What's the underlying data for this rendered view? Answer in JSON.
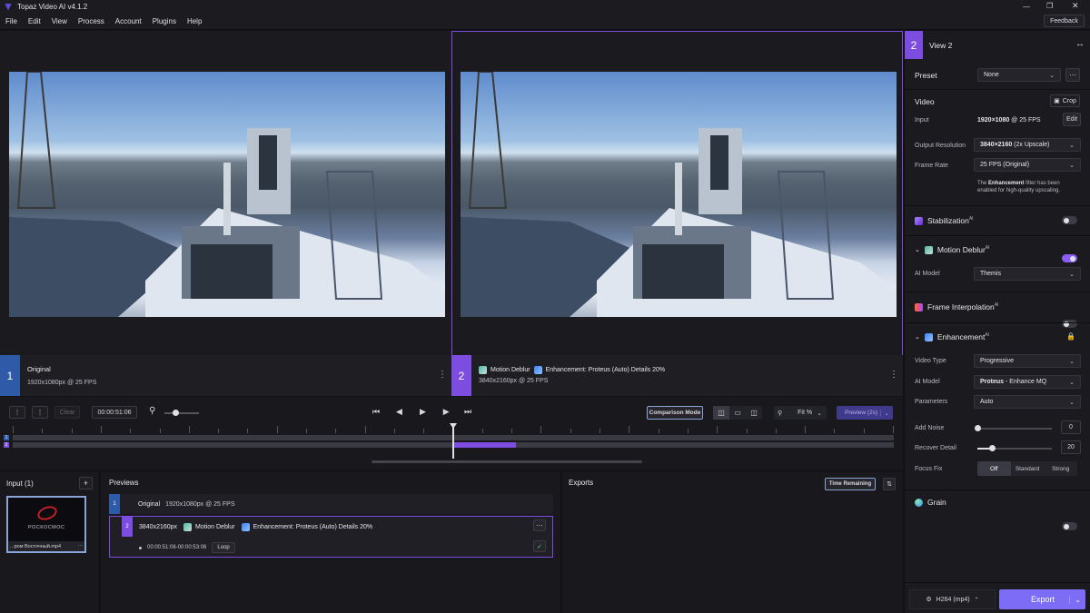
{
  "app": {
    "title": "Topaz Video AI  v4.1.2",
    "feedback": "Feedback"
  },
  "menu": [
    "File",
    "Edit",
    "View",
    "Process",
    "Account",
    "Plugins",
    "Help"
  ],
  "view1": {
    "num": "1",
    "title": "Original",
    "info": "1920x1080px @ 25 FPS"
  },
  "view2": {
    "num": "2",
    "filter1": "Motion Deblur",
    "filter2": "Enhancement: Proteus (Auto) Details 20%",
    "info": "3840x2160px @ 25 FPS"
  },
  "timeline": {
    "clear": "Clear",
    "time": "00:00:51:06",
    "comparison": "Comparison Mode",
    "zoom": "Fit %",
    "preview": "Preview (2s)",
    "track1": "1",
    "track2": "2"
  },
  "input": {
    "title": "Input (1)",
    "add": "+",
    "filename": "...ром Восточный.mp4",
    "logo": "РОСКОСМОС"
  },
  "previews": {
    "title": "Previews",
    "row1": {
      "num": "1",
      "title": "Original",
      "info": "1920x1080px @ 25 FPS"
    },
    "row2": {
      "num": "2",
      "res": "3840x2160px",
      "filter1": "Motion Deblur",
      "filter2": "Enhancement: Proteus (Auto) Details 20%",
      "range": "00:00:51:06-00:00:53:06",
      "loop": "Loop"
    }
  },
  "exports": {
    "title": "Exports",
    "time_remaining": "Time Remaining"
  },
  "right": {
    "view_num": "2",
    "view_title": "View 2",
    "preset_label": "Preset",
    "preset_value": "None",
    "video_label": "Video",
    "crop": "Crop",
    "input_label": "Input",
    "input_value_bold": "1920×1080",
    "input_value_rest": " @ 25 FPS",
    "edit": "Edit",
    "out_res_label": "Output Resolution",
    "out_res_bold": "3840×2160",
    "out_res_rest": " (2x Upscale)",
    "frame_rate_label": "Frame Rate",
    "frame_rate_value": "25 FPS (Original)",
    "note_pre": "The ",
    "note_bold": "Enhancement",
    "note_post": " filter has been enabled for high-quality upscaling.",
    "stabilization": "Stabilization",
    "motion_deblur": "Motion Deblur",
    "ai_model_label": "AI Model",
    "ai_model_value": "Themis",
    "frame_interp": "Frame Interpolation",
    "enhancement": "Enhancement",
    "video_type_label": "Video Type",
    "video_type_value": "Progressive",
    "enh_model_label": "AI Model",
    "enh_model_bold": "Proteus",
    "enh_model_rest": " - Enhance MQ",
    "params_label": "Parameters",
    "params_value": "Auto",
    "add_noise_label": "Add Noise",
    "add_noise_value": "0",
    "add_noise_level": 0,
    "recover_label": "Recover Detail",
    "recover_value": "20",
    "recover_level": 20,
    "focus_label": "Focus Fix",
    "focus_options": [
      "Off",
      "Standard",
      "Strong"
    ],
    "focus_selected": "Off",
    "grain": "Grain",
    "ai_tag": "AI",
    "codec": "H264 (mp4)",
    "export": "Export"
  },
  "colors": {
    "accent": "#8b5cf6",
    "view1": "#2f5aa8",
    "view2": "#7c4de0"
  }
}
